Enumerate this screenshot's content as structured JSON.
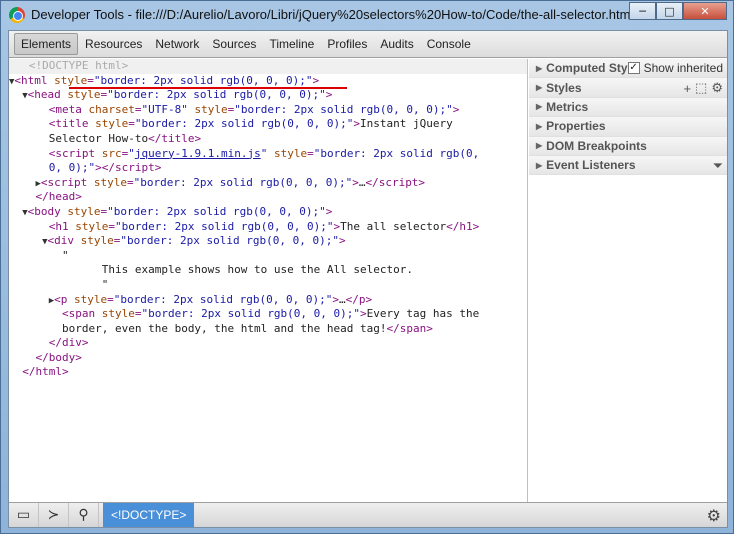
{
  "window": {
    "title": "Developer Tools - file:///D:/Aurelio/Lavoro/Libri/jQuery%20selectors%20How-to/Code/the-all-selector.html",
    "minimize_symbol": "─",
    "maximize_symbol": "□",
    "close_symbol": "✕"
  },
  "toolbar": {
    "tabs": [
      "Elements",
      "Resources",
      "Network",
      "Sources",
      "Timeline",
      "Profiles",
      "Audits",
      "Console"
    ]
  },
  "code": {
    "doctype": "<!DOCTYPE html>",
    "style_attr": "style",
    "style_val": "\"border: 2px solid rgb(0, 0, 0);\"",
    "meta_charset": "\"UTF-8\"",
    "title_text_1": "Instant jQuery",
    "title_text_2": "Selector How-to",
    "script_src": "jquery-1.9.1.min.js",
    "h1_text": "The all selector",
    "div_text": "This example shows how to use the All selector.",
    "span_text_1": "Every tag has the",
    "span_text_2": "border, even the body, the html and the head tag!",
    "quote": "\"",
    "ellipsis": "…"
  },
  "sidebar": {
    "sections": [
      {
        "label": "Computed Style"
      },
      {
        "label": "Styles"
      },
      {
        "label": "Metrics"
      },
      {
        "label": "Properties"
      },
      {
        "label": "DOM Breakpoints"
      },
      {
        "label": "Event Listeners"
      }
    ],
    "show_inherited": "Show inherited",
    "check_mark": "✓",
    "add_symbol": "+",
    "gear_symbol": "⚙",
    "funnel_symbol": "⏷"
  },
  "statusbar": {
    "breadcrumb": "<!DOCTYPE>",
    "gear_symbol": "⚙"
  },
  "colors": {
    "tag": "#881280",
    "attr_name": "#994500",
    "attr_value": "#1a1aa6",
    "breadcrumb_bg": "#4a90d9",
    "highlight_underline": "#dd0000"
  }
}
